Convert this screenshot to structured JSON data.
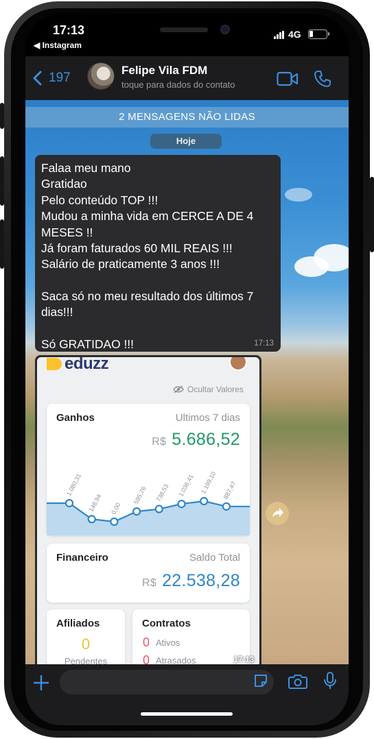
{
  "status_bar": {
    "time": "17:13",
    "back_app": "◀ Instagram",
    "network": "4G"
  },
  "header": {
    "back_count": "197",
    "contact_name": "Felipe Vila FDM",
    "contact_subtitle": "toque para dados do contato",
    "accent_color": "#3d8fe0"
  },
  "chat": {
    "unread_banner": "2 MENSAGENS NÃO LIDAS",
    "day_label": "Hoje",
    "message": {
      "lines": [
        "Falaa meu mano",
        "Gratidao",
        "Pelo conteúdo TOP !!!",
        "Mudou a minha vida em CERCE A DE 4",
        "MESES !!",
        "Já foram faturados 60 MIL REAIS !!!",
        "Salário de praticamente 3 anos !!!",
        "",
        "Saca só no meu resultado dos últimos 7",
        "dias!!!",
        "",
        "Só GRATIDAO !!!"
      ],
      "time": "17:13"
    },
    "image_message": {
      "time": "17:13",
      "eduzz": {
        "logo_text": "eduzz",
        "hide_values": "Ocultar Valores",
        "earnings": {
          "title": "Ganhos",
          "period": "Ultimos 7 dias",
          "currency": "R$",
          "amount": "5.686,52",
          "amount_color": "#1e9a64"
        },
        "financial": {
          "title": "Financeiro",
          "label": "Saldo Total",
          "currency": "R$",
          "amount": "22.538,28",
          "amount_color": "#2f86c6"
        },
        "affiliates": {
          "title": "Afiliados",
          "count": "0",
          "label": "Pendentes"
        },
        "contracts": {
          "title": "Contratos",
          "active_count": "0",
          "active_label": "Ativos",
          "late_count": "0",
          "late_label": "Atrasados"
        }
      }
    }
  },
  "chart_data": {
    "type": "area",
    "title": "",
    "labels": [
      "1.080,31",
      "148,94",
      "0,00",
      "595,76",
      "738,53",
      "1.036,41",
      "1.199,10",
      "887,47"
    ],
    "values": [
      1080.31,
      148.94,
      0.0,
      595.76,
      738.53,
      1036.41,
      1199.1,
      887.47
    ],
    "ylim": [
      0,
      1200
    ],
    "grid": false,
    "line_color": "#2f86c6",
    "fill_color": "#bcd9ef"
  }
}
